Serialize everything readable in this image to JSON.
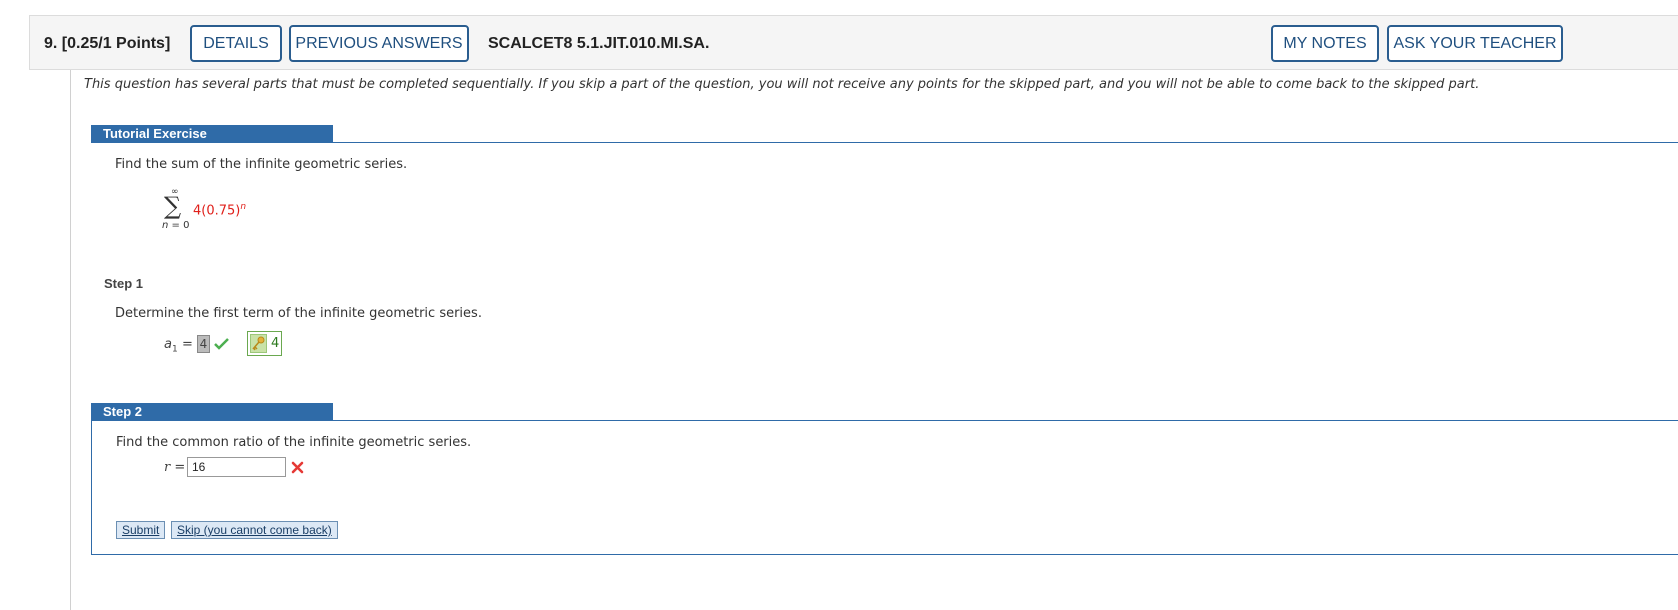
{
  "header": {
    "question_points": "9.  [0.25/1 Points]",
    "details_label": "DETAILS",
    "previous_answers_label": "PREVIOUS ANSWERS",
    "question_code": "SCALCET8 5.1.JIT.010.MI.SA.",
    "my_notes_label": "MY NOTES",
    "ask_teacher_label": "ASK YOUR TEACHER"
  },
  "notice": "This question has several parts that must be completed sequentially. If you skip a part of the question, you will not receive any points for the skipped part, and you will not be able to come back to the skipped part.",
  "tutorial": {
    "tab_label": "Tutorial Exercise",
    "prompt": "Find the sum of the infinite geometric series.",
    "sum_upper": "∞",
    "sum_symbol": "∑",
    "sum_lower_var": "n",
    "sum_lower_val": " = 0",
    "expression_base": "4(0.75)",
    "expression_exp": "n"
  },
  "step1": {
    "label": "Step 1",
    "prompt": "Determine the first term of the infinite geometric series.",
    "var": "a",
    "sub": "1",
    "equals": "=",
    "answer": "4",
    "correct_answer": "4",
    "status": "correct"
  },
  "step2": {
    "tab_label": "Step 2",
    "prompt": "Find the common ratio of the infinite geometric series.",
    "var": "r",
    "equals": " =",
    "input_value": "16",
    "status": "incorrect",
    "submit_label": "Submit",
    "skip_label": "Skip (you cannot come back)"
  },
  "colors": {
    "accent": "#2f6ba8",
    "correct": "#4caf50",
    "incorrect": "#e53935",
    "expression": "#e0201b"
  }
}
